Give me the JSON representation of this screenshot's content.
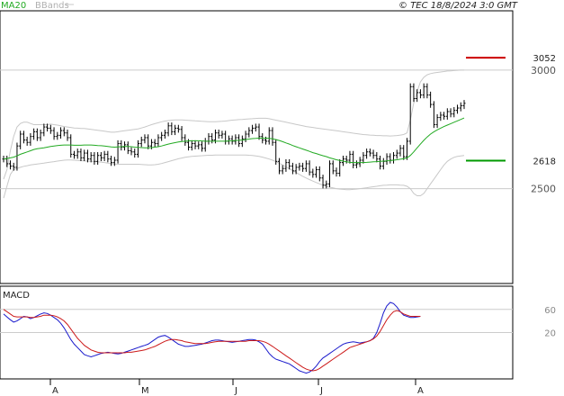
{
  "header": {
    "legend_ma": "MA20",
    "legend_bbands": "BBands",
    "copyright": "© TEC 18/8/2024 3:0 GMT"
  },
  "colors": {
    "ma": "#22aa22",
    "bbands": "#c8c8c8",
    "bars": "#000000",
    "resistance": "#cc0000",
    "support": "#009900",
    "macd": "#1a1acc",
    "signal": "#cc1a1a",
    "grid": "#cccccc"
  },
  "chart_data": [
    {
      "type": "line",
      "name": "price",
      "y_axis_ticks": [
        "3000",
        "2500"
      ],
      "ylim": [
        2100,
        3250
      ],
      "x_months": [
        "A",
        "M",
        "J",
        "J",
        "A"
      ],
      "levels": [
        {
          "label": "3052",
          "value": 3052,
          "role": "resistance"
        },
        {
          "label": "2618",
          "value": 2618,
          "role": "support"
        }
      ],
      "ohlc_close": [
        2625,
        2605,
        2595,
        2590,
        2680,
        2730,
        2705,
        2695,
        2720,
        2740,
        2715,
        2735,
        2760,
        2755,
        2745,
        2720,
        2725,
        2745,
        2735,
        2715,
        2645,
        2640,
        2655,
        2630,
        2650,
        2625,
        2640,
        2615,
        2640,
        2630,
        2645,
        2625,
        2610,
        2620,
        2690,
        2675,
        2685,
        2660,
        2655,
        2645,
        2690,
        2705,
        2715,
        2680,
        2695,
        2690,
        2715,
        2725,
        2735,
        2765,
        2740,
        2755,
        2750,
        2715,
        2695,
        2675,
        2690,
        2680,
        2685,
        2670,
        2700,
        2720,
        2705,
        2735,
        2725,
        2730,
        2700,
        2710,
        2700,
        2715,
        2690,
        2710,
        2730,
        2745,
        2755,
        2760,
        2720,
        2705,
        2700,
        2745,
        2695,
        2615,
        2575,
        2585,
        2610,
        2595,
        2575,
        2590,
        2595,
        2585,
        2605,
        2570,
        2560,
        2580,
        2545,
        2515,
        2520,
        2605,
        2575,
        2565,
        2610,
        2625,
        2620,
        2645,
        2600,
        2605,
        2620,
        2640,
        2655,
        2650,
        2640,
        2625,
        2595,
        2615,
        2635,
        2620,
        2640,
        2650,
        2670,
        2635,
        2700,
        2930,
        2880,
        2905,
        2895,
        2930,
        2895,
        2855,
        2770,
        2800,
        2810,
        2805,
        2825,
        2815,
        2830,
        2840,
        2850,
        2860
      ],
      "ma20": [
        2625,
        2627,
        2630,
        2633,
        2638,
        2645,
        2650,
        2655,
        2660,
        2665,
        2668,
        2670,
        2672,
        2675,
        2678,
        2680,
        2682,
        2683,
        2684,
        2684,
        2684,
        2683,
        2683,
        2683,
        2684,
        2684,
        2684,
        2683,
        2682,
        2681,
        2680,
        2678,
        2676,
        2675,
        2676,
        2677,
        2678,
        2678,
        2677,
        2675,
        2674,
        2673,
        2672,
        2672,
        2673,
        2675,
        2677,
        2680,
        2684,
        2688,
        2691,
        2694,
        2697,
        2699,
        2700,
        2701,
        2702,
        2702,
        2702,
        2701,
        2700,
        2700,
        2700,
        2700,
        2700,
        2700,
        2700,
        2701,
        2702,
        2703,
        2704,
        2705,
        2707,
        2709,
        2711,
        2712,
        2713,
        2713,
        2713,
        2712,
        2710,
        2707,
        2703,
        2698,
        2693,
        2688,
        2682,
        2677,
        2672,
        2667,
        2662,
        2657,
        2652,
        2648,
        2643,
        2639,
        2635,
        2630,
        2626,
        2622,
        2619,
        2616,
        2613,
        2611,
        2610,
        2610,
        2610,
        2610,
        2611,
        2612,
        2613,
        2614,
        2615,
        2616,
        2617,
        2618,
        2620,
        2622,
        2624,
        2626,
        2630,
        2640,
        2655,
        2672,
        2688,
        2704,
        2718,
        2730,
        2740,
        2748,
        2755,
        2762,
        2768,
        2774,
        2780,
        2786,
        2792,
        2798
      ],
      "bb_upper": [
        2540,
        2580,
        2660,
        2720,
        2760,
        2775,
        2780,
        2780,
        2775,
        2770,
        2770,
        2770,
        2770,
        2770,
        2772,
        2770,
        2768,
        2765,
        2762,
        2760,
        2758,
        2756,
        2755,
        2754,
        2754,
        2752,
        2750,
        2748,
        2746,
        2744,
        2742,
        2740,
        2738,
        2738,
        2740,
        2742,
        2744,
        2746,
        2748,
        2750,
        2752,
        2756,
        2760,
        2765,
        2770,
        2774,
        2778,
        2782,
        2785,
        2787,
        2789,
        2790,
        2790,
        2790,
        2789,
        2788,
        2787,
        2786,
        2785,
        2784,
        2783,
        2782,
        2782,
        2782,
        2783,
        2784,
        2785,
        2787,
        2789,
        2790,
        2791,
        2792,
        2793,
        2794,
        2795,
        2796,
        2797,
        2797,
        2797,
        2795,
        2792,
        2789,
        2786,
        2783,
        2780,
        2777,
        2774,
        2771,
        2768,
        2765,
        2762,
        2760,
        2758,
        2756,
        2754,
        2752,
        2750,
        2748,
        2746,
        2744,
        2742,
        2740,
        2738,
        2736,
        2734,
        2732,
        2730,
        2728,
        2727,
        2726,
        2725,
        2724,
        2724,
        2723,
        2723,
        2722,
        2723,
        2724,
        2726,
        2728,
        2735,
        2790,
        2860,
        2910,
        2950,
        2970,
        2980,
        2985,
        2988,
        2990,
        2992,
        2994,
        2996,
        2997,
        2998,
        2999,
        3000,
        3000
      ],
      "bb_lower": [
        2460,
        2510,
        2560,
        2580,
        2585,
        2590,
        2594,
        2597,
        2600,
        2602,
        2604,
        2606,
        2608,
        2610,
        2612,
        2614,
        2616,
        2618,
        2620,
        2621,
        2621,
        2620,
        2619,
        2618,
        2617,
        2616,
        2615,
        2614,
        2613,
        2612,
        2610,
        2608,
        2606,
        2604,
        2603,
        2603,
        2603,
        2603,
        2603,
        2603,
        2603,
        2602,
        2601,
        2600,
        2600,
        2601,
        2603,
        2606,
        2610,
        2614,
        2618,
        2622,
        2626,
        2629,
        2632,
        2634,
        2636,
        2637,
        2638,
        2639,
        2640,
        2641,
        2641,
        2642,
        2642,
        2642,
        2642,
        2642,
        2642,
        2642,
        2642,
        2642,
        2642,
        2641,
        2640,
        2638,
        2636,
        2633,
        2629,
        2625,
        2620,
        2614,
        2607,
        2600,
        2592,
        2584,
        2576,
        2568,
        2560,
        2552,
        2545,
        2538,
        2532,
        2526,
        2520,
        2515,
        2510,
        2506,
        2503,
        2500,
        2498,
        2497,
        2496,
        2496,
        2497,
        2498,
        2500,
        2502,
        2504,
        2506,
        2508,
        2510,
        2512,
        2514,
        2515,
        2516,
        2516,
        2516,
        2515,
        2514,
        2510,
        2500,
        2480,
        2470,
        2470,
        2480,
        2500,
        2520,
        2540,
        2560,
        2580,
        2600,
        2615,
        2625,
        2632,
        2636,
        2638,
        2640
      ]
    },
    {
      "type": "line",
      "name": "MACD",
      "title": "MACD",
      "y_axis_ticks": [
        "60",
        "20"
      ],
      "ylim": [
        -60,
        100
      ],
      "series": [
        {
          "name": "",
          "role": "macd",
          "values": [
            52,
            47,
            42,
            38,
            40,
            44,
            48,
            47,
            44,
            46,
            49,
            52,
            54,
            53,
            50,
            46,
            42,
            36,
            28,
            18,
            8,
            0,
            -6,
            -12,
            -18,
            -20,
            -22,
            -20,
            -18,
            -16,
            -15,
            -14,
            -15,
            -16,
            -17,
            -16,
            -14,
            -12,
            -10,
            -8,
            -6,
            -4,
            -2,
            0,
            4,
            8,
            12,
            14,
            15,
            12,
            8,
            4,
            0,
            -2,
            -4,
            -4,
            -3,
            -2,
            -1,
            0,
            2,
            4,
            6,
            7,
            7,
            6,
            5,
            4,
            3,
            4,
            5,
            6,
            7,
            8,
            8,
            7,
            4,
            0,
            -8,
            -16,
            -22,
            -26,
            -28,
            -30,
            -32,
            -34,
            -38,
            -42,
            -46,
            -48,
            -50,
            -48,
            -44,
            -38,
            -30,
            -24,
            -20,
            -16,
            -12,
            -8,
            -4,
            0,
            2,
            3,
            4,
            3,
            2,
            3,
            4,
            6,
            10,
            20,
            36,
            54,
            66,
            72,
            70,
            64,
            56,
            50,
            48,
            46,
            46,
            47,
            48
          ]
        },
        {
          "name": "",
          "role": "signal",
          "values": [
            60,
            56,
            52,
            48,
            47,
            47,
            47,
            47,
            46,
            46,
            47,
            48,
            50,
            50,
            50,
            49,
            47,
            44,
            40,
            34,
            26,
            18,
            10,
            4,
            -2,
            -6,
            -10,
            -12,
            -14,
            -15,
            -15,
            -15,
            -15,
            -15,
            -15,
            -15,
            -15,
            -14,
            -14,
            -13,
            -12,
            -11,
            -10,
            -8,
            -6,
            -4,
            -1,
            2,
            5,
            7,
            8,
            8,
            7,
            6,
            4,
            3,
            2,
            1,
            1,
            1,
            1,
            2,
            3,
            4,
            5,
            5,
            5,
            5,
            5,
            5,
            5,
            5,
            5,
            6,
            6,
            6,
            6,
            5,
            3,
            0,
            -4,
            -8,
            -12,
            -16,
            -20,
            -24,
            -28,
            -32,
            -36,
            -40,
            -43,
            -45,
            -46,
            -45,
            -42,
            -38,
            -34,
            -30,
            -26,
            -22,
            -18,
            -14,
            -10,
            -6,
            -4,
            -2,
            0,
            2,
            4,
            6,
            9,
            14,
            22,
            32,
            42,
            50,
            56,
            58,
            56,
            52,
            50,
            48,
            48,
            48,
            48
          ]
        }
      ]
    }
  ]
}
